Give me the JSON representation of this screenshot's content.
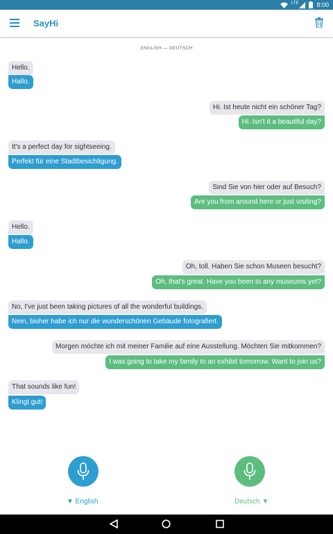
{
  "status_bar": {
    "time": "8:00",
    "network": "LTE",
    "icons": [
      "wifi-icon",
      "signal-icon",
      "battery-icon"
    ]
  },
  "app_bar": {
    "title": "SayHi",
    "icons": [
      "menu-icon",
      "trash-icon"
    ]
  },
  "conversation": {
    "language_pair": "ENGLISH — DEUTSCH",
    "messages": [
      {
        "side": "left",
        "original": "Hello.",
        "translation": "Hallo."
      },
      {
        "side": "right",
        "original": "Hi. Ist heute nicht ein schöner Tag?",
        "translation": "Hi. Isn't it a beautiful day?"
      },
      {
        "side": "left",
        "original": "It's a perfect day for sightseeing.",
        "translation": "Perfekt für eine Stadtbesichtigung."
      },
      {
        "side": "right",
        "original": "Sind Sie von hier oder auf Besuch?",
        "translation": "Are you from around here or just visiting?"
      },
      {
        "side": "left",
        "original": "Hello.",
        "translation": "Hallo."
      },
      {
        "side": "right",
        "original": "Oh, toll. Haben Sie schon Museen besucht?",
        "translation": "Oh, that's great. Have you been to any museums yet?"
      },
      {
        "side": "left",
        "original": "No, I've just been taking pictures of all the wonderful buildings.",
        "translation": "Nein, bisher habe ich nur die wunderschönen Gebäude fotografiert."
      },
      {
        "side": "right",
        "original": "Morgen möchte ich mit meiner Familie auf eine Ausstellung. Möchten Sie mitkommen?",
        "translation": "I was going to take my family to an exhibit tomorrow. Want to join us?"
      },
      {
        "side": "left",
        "original": "That sounds like fun!",
        "translation": "Klingt gut!"
      }
    ]
  },
  "footer": {
    "left_language": "▼ English",
    "right_language": "Deutsch ▼",
    "left_mic_color": "#2e9dd0",
    "right_mic_color": "#5dbd7f"
  },
  "nav_bar": {
    "icons": [
      "back-icon",
      "home-icon",
      "recents-icon"
    ]
  },
  "colors": {
    "accent_blue": "#2e9dd0",
    "accent_green": "#5dbd7f",
    "bubble_gray": "#e6e6ec",
    "status_bar": "#2a7fa8"
  }
}
